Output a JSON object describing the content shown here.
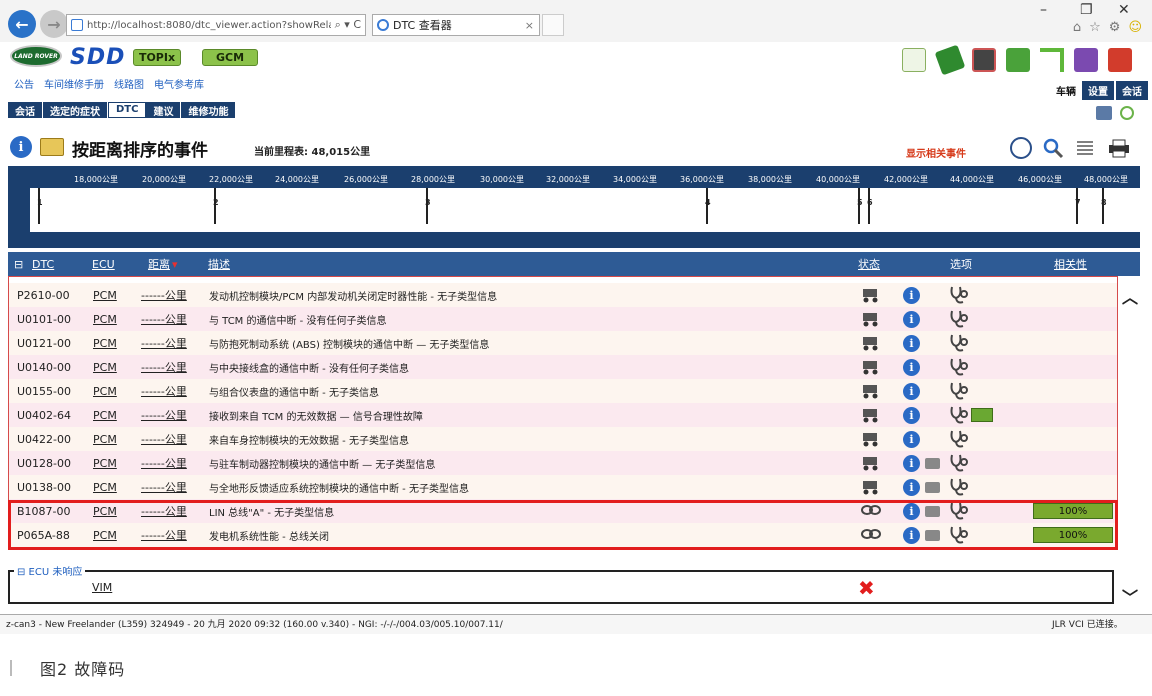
{
  "browser": {
    "url": "http://localhost:8080/dtc_viewer.action?showRelat",
    "address_controls": "⌕ ▾ C",
    "tab_title": "DTC 查看器",
    "window_controls": [
      "–",
      "❐",
      "✕"
    ]
  },
  "app": {
    "logo_text": "LAND ROVER",
    "brand": "SDD",
    "buttons": [
      "TOPIx",
      "GCM"
    ],
    "links": [
      "公告",
      "车间维修手册",
      "线路图",
      "电气参考库"
    ],
    "right_tabs": [
      "车辆",
      "设置",
      "会话"
    ]
  },
  "subtabs": [
    "会话",
    "选定的症状",
    "DTC",
    "建议",
    "维修功能"
  ],
  "active_subtab": "DTC",
  "page": {
    "title": "按距离排序的事件",
    "odometer": "当前里程表: 48,015公里",
    "show_related": "显示相关事件"
  },
  "timeline": {
    "labels": [
      "18,000公里",
      "20,000公里",
      "22,000公里",
      "24,000公里",
      "26,000公里",
      "28,000公里",
      "30,000公里",
      "32,000公里",
      "34,000公里",
      "36,000公里",
      "38,000公里",
      "40,000公里",
      "42,000公里",
      "44,000公里",
      "46,000公里",
      "48,000公里"
    ],
    "markers": [
      "1",
      "2",
      "3",
      "4",
      "5",
      "6",
      "7",
      "8"
    ]
  },
  "table": {
    "headers": {
      "toggle": "⊟",
      "dtc": "DTC",
      "ecu": "ECU",
      "distance": "距离",
      "sort_mark": "▾",
      "description": "描述",
      "status": "状态",
      "options": "选项",
      "relevance": "相关性"
    },
    "rows": [
      {
        "dtc": "P2610-00",
        "ecu": "PCM",
        "distance": "------公里",
        "desc": "发动机控制模块/PCM 内部发动机关闭定时器性能 - 无子类型信息",
        "relevance": ""
      },
      {
        "dtc": "U0101-00",
        "ecu": "PCM",
        "distance": "------公里",
        "desc": "与 TCM 的通信中断 - 没有任何子类信息",
        "relevance": ""
      },
      {
        "dtc": "U0121-00",
        "ecu": "PCM",
        "distance": "------公里",
        "desc": "与防抱死制动系统 (ABS) 控制模块的通信中断 — 无子类型信息",
        "relevance": ""
      },
      {
        "dtc": "U0140-00",
        "ecu": "PCM",
        "distance": "------公里",
        "desc": "与中央接线盒的通信中断 - 没有任何子类信息",
        "relevance": ""
      },
      {
        "dtc": "U0155-00",
        "ecu": "PCM",
        "distance": "------公里",
        "desc": "与组合仪表盘的通信中断 - 无子类信息",
        "relevance": ""
      },
      {
        "dtc": "U0402-64",
        "ecu": "PCM",
        "distance": "------公里",
        "desc": "接收到来自 TCM 的无效数据 — 信号合理性故障",
        "relevance": ""
      },
      {
        "dtc": "U0422-00",
        "ecu": "PCM",
        "distance": "------公里",
        "desc": "来自车身控制模块的无效数据 - 无子类型信息",
        "relevance": ""
      },
      {
        "dtc": "U0128-00",
        "ecu": "PCM",
        "distance": "------公里",
        "desc": "与驻车制动器控制模块的通信中断 — 无子类型信息",
        "relevance": ""
      },
      {
        "dtc": "U0138-00",
        "ecu": "PCM",
        "distance": "------公里",
        "desc": "与全地形反馈适应系统控制模块的通信中断 - 无子类型信息",
        "relevance": ""
      },
      {
        "dtc": "B1087-00",
        "ecu": "PCM",
        "distance": "------公里",
        "desc": "LIN 总线\"A\" - 无子类型信息",
        "relevance": "100%"
      },
      {
        "dtc": "P065A-88",
        "ecu": "PCM",
        "distance": "------公里",
        "desc": "发电机系统性能 - 总线关闭",
        "relevance": "100%"
      }
    ]
  },
  "ecu_no_response": {
    "title": "⊟ ECU 未响应",
    "ecu": "VIM"
  },
  "status_bar": {
    "left": "z-can3 - New Freelander (L359) 324949 - 20 九月 2020 09:32 (160.00 v.340) - NGI: -/-/-/004.03/005.10/007.11/",
    "right": "JLR VCI 已连接。"
  },
  "caption": "图2    故障码",
  "colors": {
    "nav_dark": "#1b3f6e",
    "header_blue": "#2e5b95",
    "green": "#7aa92e",
    "highlight_red": "#e21d1d"
  }
}
